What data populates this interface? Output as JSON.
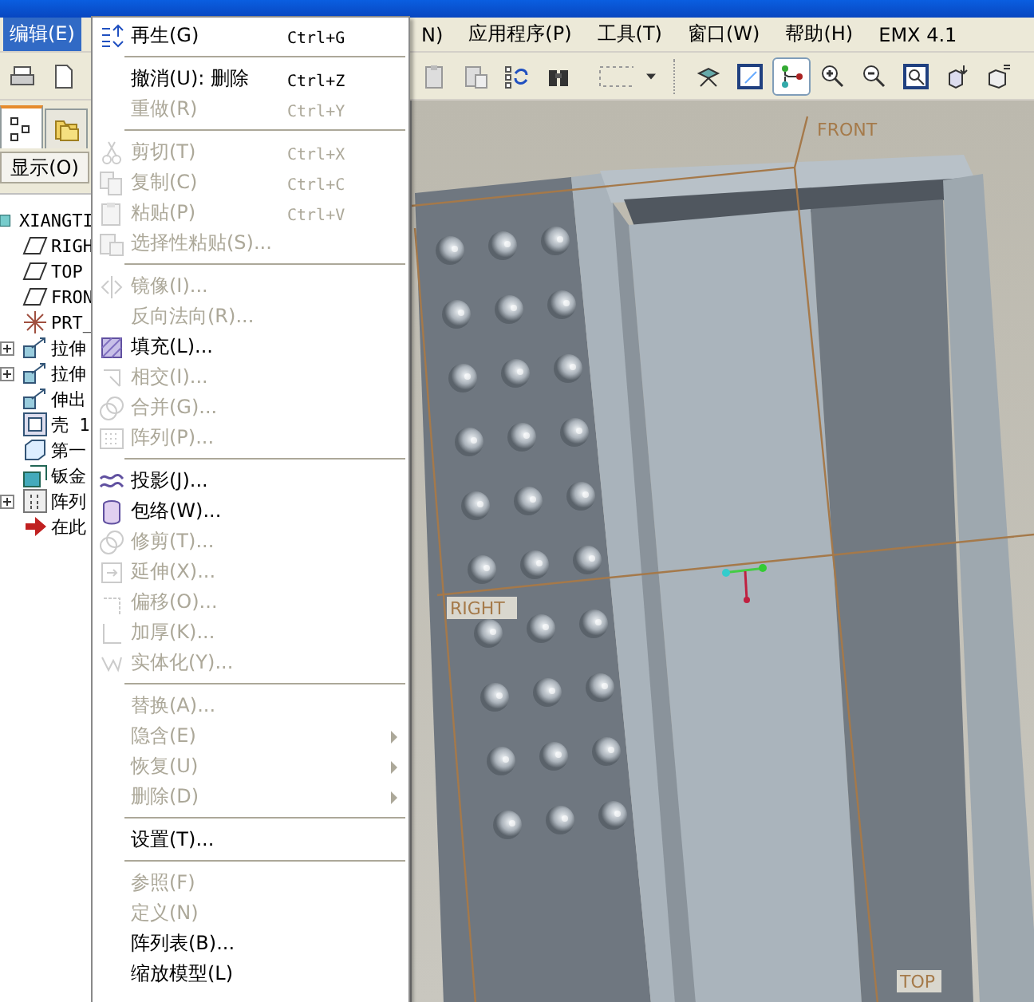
{
  "menubar": [
    {
      "label": "编辑(E)",
      "selected": true
    },
    {
      "label": "N)",
      "selected": false
    },
    {
      "label": "应用程序(P)",
      "selected": false
    },
    {
      "label": "工具(T)",
      "selected": false
    },
    {
      "label": "窗口(W)",
      "selected": false
    },
    {
      "label": "帮助(H)",
      "selected": false
    },
    {
      "label": "EMX 4.1",
      "selected": false
    }
  ],
  "edit_menu": [
    {
      "kind": "item",
      "label": "再生(G)",
      "shortcut": "Ctrl+G",
      "disabled": false,
      "submenu": false
    },
    {
      "kind": "separator"
    },
    {
      "kind": "item",
      "label": "撤消(U): 删除",
      "shortcut": "Ctrl+Z",
      "disabled": false,
      "submenu": false
    },
    {
      "kind": "item",
      "label": "重做(R)",
      "shortcut": "Ctrl+Y",
      "disabled": true,
      "submenu": false
    },
    {
      "kind": "separator"
    },
    {
      "kind": "item",
      "label": "剪切(T)",
      "shortcut": "Ctrl+X",
      "disabled": true,
      "submenu": false
    },
    {
      "kind": "item",
      "label": "复制(C)",
      "shortcut": "Ctrl+C",
      "disabled": true,
      "submenu": false
    },
    {
      "kind": "item",
      "label": "粘贴(P)",
      "shortcut": "Ctrl+V",
      "disabled": true,
      "submenu": false
    },
    {
      "kind": "item",
      "label": "选择性粘贴(S)...",
      "disabled": true,
      "submenu": false
    },
    {
      "kind": "separator"
    },
    {
      "kind": "item",
      "label": "镜像(I)...",
      "disabled": true,
      "submenu": false
    },
    {
      "kind": "item",
      "label": "反向法向(R)...",
      "disabled": true,
      "submenu": false
    },
    {
      "kind": "item",
      "label": "填充(L)...",
      "disabled": false,
      "submenu": false
    },
    {
      "kind": "item",
      "label": "相交(I)...",
      "disabled": true,
      "submenu": false
    },
    {
      "kind": "item",
      "label": "合并(G)...",
      "disabled": true,
      "submenu": false
    },
    {
      "kind": "item",
      "label": "阵列(P)...",
      "disabled": true,
      "submenu": false
    },
    {
      "kind": "separator"
    },
    {
      "kind": "item",
      "label": "投影(J)...",
      "disabled": false,
      "submenu": false
    },
    {
      "kind": "item",
      "label": "包络(W)...",
      "disabled": false,
      "submenu": false
    },
    {
      "kind": "item",
      "label": "修剪(T)...",
      "disabled": true,
      "submenu": false
    },
    {
      "kind": "item",
      "label": "延伸(X)...",
      "disabled": true,
      "submenu": false
    },
    {
      "kind": "item",
      "label": "偏移(O)...",
      "disabled": true,
      "submenu": false
    },
    {
      "kind": "item",
      "label": "加厚(K)...",
      "disabled": true,
      "submenu": false
    },
    {
      "kind": "item",
      "label": "实体化(Y)...",
      "disabled": true,
      "submenu": false
    },
    {
      "kind": "separator"
    },
    {
      "kind": "item",
      "label": "替换(A)...",
      "disabled": true,
      "submenu": false
    },
    {
      "kind": "item",
      "label": "隐含(E)",
      "disabled": true,
      "submenu": true
    },
    {
      "kind": "item",
      "label": "恢复(U)",
      "disabled": true,
      "submenu": true
    },
    {
      "kind": "item",
      "label": "删除(D)",
      "disabled": true,
      "submenu": true
    },
    {
      "kind": "separator"
    },
    {
      "kind": "item",
      "label": "设置(T)...",
      "disabled": false,
      "submenu": false
    },
    {
      "kind": "separator"
    },
    {
      "kind": "item",
      "label": "参照(F)",
      "disabled": true,
      "submenu": false
    },
    {
      "kind": "item",
      "label": "定义(N)",
      "disabled": true,
      "submenu": false
    },
    {
      "kind": "item",
      "label": "阵列表(B)...",
      "disabled": false,
      "submenu": false
    },
    {
      "kind": "item",
      "label": "缩放模型(L)",
      "disabled": false,
      "submenu": false
    }
  ],
  "navigator_tabs": [
    {
      "selected": true
    },
    {
      "selected": false
    }
  ],
  "display_button": "显示(O)",
  "model_tree": {
    "label": "XIANGTI",
    "children": [
      {
        "kind": "plane",
        "label": "RIGH",
        "expandable": false
      },
      {
        "kind": "plane",
        "label": "TOP",
        "expandable": false
      },
      {
        "kind": "plane",
        "label": "FRON",
        "expandable": false
      },
      {
        "kind": "csys",
        "label": "PRT_",
        "expandable": false
      },
      {
        "kind": "extrude",
        "label": "拉伸",
        "expandable": true
      },
      {
        "kind": "extrude",
        "label": "拉伸",
        "expandable": true
      },
      {
        "kind": "extrude",
        "label": "伸出",
        "expandable": false
      },
      {
        "kind": "shell",
        "label": "壳 1",
        "expandable": false
      },
      {
        "kind": "wall",
        "label": "第一",
        "expandable": false
      },
      {
        "kind": "sheetmetal",
        "label": "钣金",
        "expandable": false
      },
      {
        "kind": "pattern",
        "label": "阵列",
        "expandable": true
      },
      {
        "kind": "insert",
        "label": "在此",
        "expandable": false
      }
    ]
  },
  "viewport": {
    "datum_labels": [
      "FRONT",
      "RIGHT",
      "TOP"
    ]
  }
}
